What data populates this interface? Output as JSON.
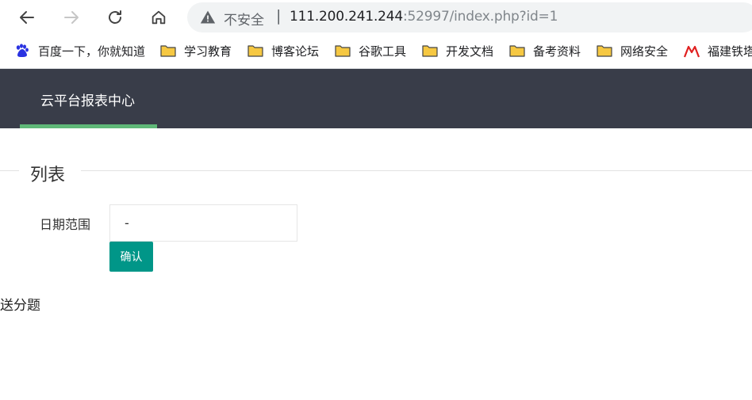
{
  "browser": {
    "security_label": "不安全",
    "url_host": "111.200.241.244",
    "url_rest": ":52997/index.php?id=1"
  },
  "bookmarks": [
    {
      "label": "百度一下，你就知道",
      "icon": "baidu-icon"
    },
    {
      "label": "学习教育",
      "icon": "folder-icon"
    },
    {
      "label": "博客论坛",
      "icon": "folder-icon"
    },
    {
      "label": "谷歌工具",
      "icon": "folder-icon"
    },
    {
      "label": "开发文档",
      "icon": "folder-icon"
    },
    {
      "label": "备考资料",
      "icon": "folder-icon"
    },
    {
      "label": "网络安全",
      "icon": "folder-icon"
    },
    {
      "label": "福建铁塔",
      "icon": "tower-icon"
    }
  ],
  "app": {
    "title": "云平台报表中心"
  },
  "form": {
    "legend": "列表",
    "date_label": "日期范围",
    "date_value": "-",
    "confirm_label": "确认"
  },
  "footer_text": "送分题",
  "colors": {
    "appbar": "#393d49",
    "active_underline": "#5fb878",
    "confirm_button": "#009688",
    "folder": "#f6c842"
  }
}
